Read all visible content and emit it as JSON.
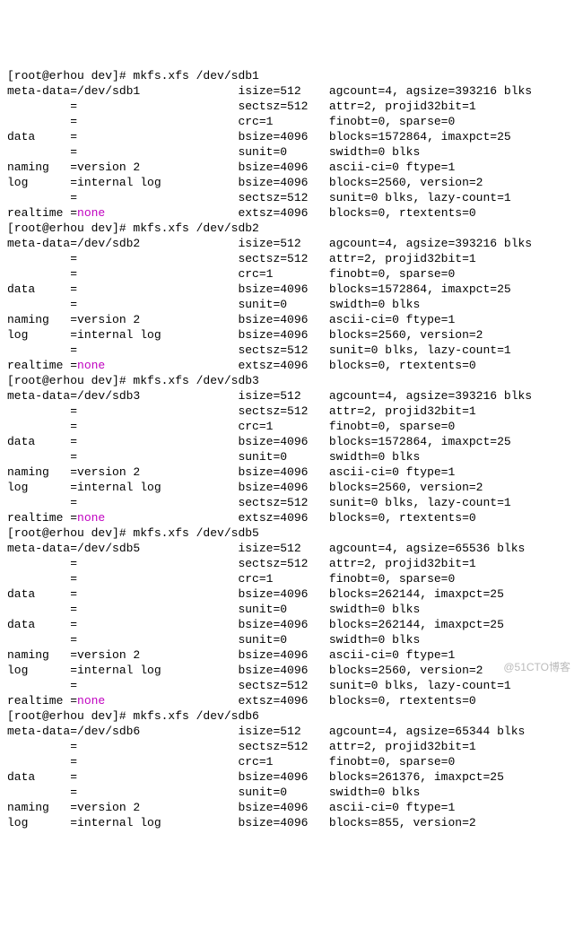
{
  "watermark": "@51CTO博客",
  "prompt": {
    "userhost": "[root@erhou dev]#",
    "cmd_prefix": "mkfs.xfs"
  },
  "blocks": [
    {
      "device": "/dev/sdb1",
      "lines": [
        "meta-data=/dev/sdb1              isize=512    agcount=4, agsize=393216 blks",
        "         =                       sectsz=512   attr=2, projid32bit=1",
        "         =                       crc=1        finobt=0, sparse=0",
        "data     =                       bsize=4096   blocks=1572864, imaxpct=25",
        "         =                       sunit=0      swidth=0 blks",
        "naming   =version 2              bsize=4096   ascii-ci=0 ftype=1",
        "log      =internal log           bsize=4096   blocks=2560, version=2",
        "         =                       sectsz=512   sunit=0 blks, lazy-count=1",
        "realtime =__NONE__                   extsz=4096   blocks=0, rtextents=0"
      ]
    },
    {
      "device": "/dev/sdb2",
      "lines": [
        "meta-data=/dev/sdb2              isize=512    agcount=4, agsize=393216 blks",
        "         =                       sectsz=512   attr=2, projid32bit=1",
        "         =                       crc=1        finobt=0, sparse=0",
        "data     =                       bsize=4096   blocks=1572864, imaxpct=25",
        "         =                       sunit=0      swidth=0 blks",
        "naming   =version 2              bsize=4096   ascii-ci=0 ftype=1",
        "log      =internal log           bsize=4096   blocks=2560, version=2",
        "         =                       sectsz=512   sunit=0 blks, lazy-count=1",
        "realtime =__NONE__                   extsz=4096   blocks=0, rtextents=0"
      ]
    },
    {
      "device": "/dev/sdb3",
      "lines": [
        "meta-data=/dev/sdb3              isize=512    agcount=4, agsize=393216 blks",
        "         =                       sectsz=512   attr=2, projid32bit=1",
        "         =                       crc=1        finobt=0, sparse=0",
        "data     =                       bsize=4096   blocks=1572864, imaxpct=25",
        "         =                       sunit=0      swidth=0 blks",
        "naming   =version 2              bsize=4096   ascii-ci=0 ftype=1",
        "log      =internal log           bsize=4096   blocks=2560, version=2",
        "         =                       sectsz=512   sunit=0 blks, lazy-count=1",
        "realtime =__NONE__                   extsz=4096   blocks=0, rtextents=0"
      ]
    },
    {
      "device": "/dev/sdb5",
      "lines": [
        "meta-data=/dev/sdb5              isize=512    agcount=4, agsize=65536 blks",
        "         =                       sectsz=512   attr=2, projid32bit=1",
        "         =                       crc=1        finobt=0, sparse=0",
        "data     =                       bsize=4096   blocks=262144, imaxpct=25",
        "         =                       sunit=0      swidth=0 blks",
        "",
        "data     =                       bsize=4096   blocks=262144, imaxpct=25",
        "         =                       sunit=0      swidth=0 blks",
        "naming   =version 2              bsize=4096   ascii-ci=0 ftype=1",
        "log      =internal log           bsize=4096   blocks=2560, version=2",
        "         =                       sectsz=512   sunit=0 blks, lazy-count=1",
        "realtime =__NONE__                   extsz=4096   blocks=0, rtextents=0"
      ]
    },
    {
      "device": "/dev/sdb6",
      "lines": [
        "meta-data=/dev/sdb6              isize=512    agcount=4, agsize=65344 blks",
        "         =                       sectsz=512   attr=2, projid32bit=1",
        "         =                       crc=1        finobt=0, sparse=0",
        "data     =                       bsize=4096   blocks=261376, imaxpct=25",
        "         =                       sunit=0      swidth=0 blks",
        "naming   =version 2              bsize=4096   ascii-ci=0 ftype=1",
        "log      =internal log           bsize=4096   blocks=855, version=2"
      ]
    }
  ]
}
